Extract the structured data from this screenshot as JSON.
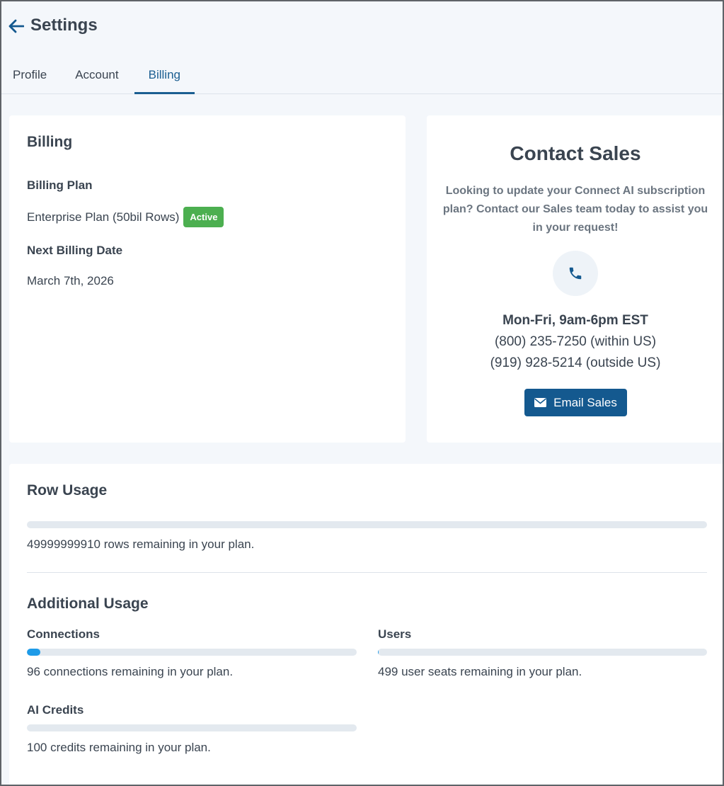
{
  "header": {
    "title": "Settings",
    "tabs": [
      {
        "label": "Profile"
      },
      {
        "label": "Account"
      },
      {
        "label": "Billing"
      }
    ],
    "active_tab": "Billing"
  },
  "billing": {
    "heading": "Billing",
    "plan_label": "Billing Plan",
    "plan_value": "Enterprise Plan (50bil Rows)",
    "plan_status": "Active",
    "next_date_label": "Next Billing Date",
    "next_date_value": "March 7th, 2026"
  },
  "sales": {
    "heading": "Contact Sales",
    "description": "Looking to update your Connect AI subscription plan? Contact our Sales team today to assist you in your request!",
    "hours": "Mon-Fri, 9am-6pm EST",
    "phone_us": "(800) 235-7250 (within US)",
    "phone_intl": "(919) 928-5214 (outside US)",
    "email_button": "Email Sales"
  },
  "usage": {
    "row_heading": "Row Usage",
    "row_text": "49999999910 rows remaining in your plan.",
    "row_fill_pct": 0,
    "additional_heading": "Additional Usage",
    "connections_label": "Connections",
    "connections_text": "96 connections remaining in your plan.",
    "connections_fill_pct": 4,
    "users_label": "Users",
    "users_text": "499 user seats remaining in your plan.",
    "users_fill_pct": 0.2,
    "credits_label": "AI Credits",
    "credits_text": "100 credits remaining in your plan.",
    "credits_fill_pct": 0
  },
  "colors": {
    "accent": "#14598f",
    "active_badge": "#4caf50",
    "progress_fill": "#1e9be8",
    "progress_track": "#e3e9ef"
  }
}
